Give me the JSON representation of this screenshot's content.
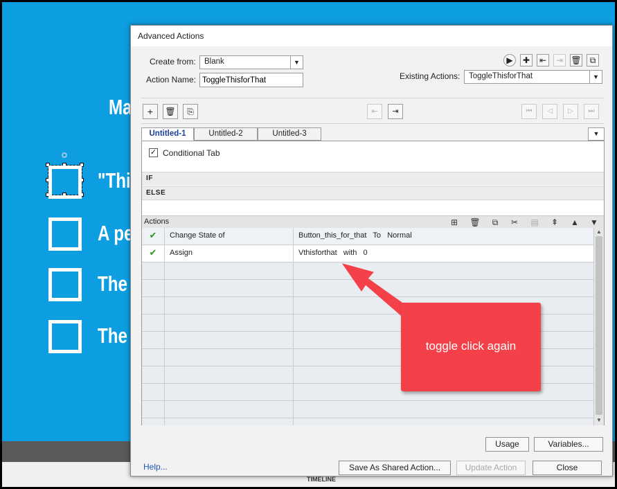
{
  "stage": {
    "title_fragment": "Ma",
    "options": [
      "\"This",
      "A pe",
      "The",
      "The"
    ]
  },
  "timeline": {
    "label": "TIMELINE"
  },
  "dialog": {
    "title": "Advanced Actions",
    "create_from": {
      "label": "Create from:",
      "value": "Blank"
    },
    "action_name": {
      "label": "Action Name:",
      "value": "ToggleThisforThat"
    },
    "existing_actions": {
      "label": "Existing Actions:",
      "value": "ToggleThisforThat"
    },
    "top_icons": [
      "preview-icon",
      "add-action-icon",
      "import-icon",
      "export-icon",
      "delete-action-icon",
      "duplicate-action-icon"
    ],
    "decision_icons": [
      "add-decision-icon",
      "delete-decision-icon",
      "duplicate-decision-icon"
    ],
    "tabs": [
      {
        "label": "Untitled-1",
        "active": true
      },
      {
        "label": "Untitled-2",
        "active": false
      },
      {
        "label": "Untitled-3",
        "active": false
      }
    ],
    "conditional_tab": {
      "label": "Conditional Tab",
      "checked": true
    },
    "if_label": "IF",
    "else_label": "ELSE",
    "actions_label": "Actions",
    "rows": [
      {
        "check": "✔",
        "action": "Change State of",
        "target": "Button_this_for_that   To   Normal"
      },
      {
        "check": "✔",
        "action": "Assign",
        "target": "Vthisforthat   with   0"
      }
    ],
    "empty_rows": 10,
    "buttons": {
      "usage": "Usage",
      "variables": "Variables...",
      "save_shared": "Save As Shared Action...",
      "update": "Update Action",
      "close": "Close"
    },
    "help": "Help..."
  },
  "annotation": {
    "text": "toggle click again",
    "color": "#f44149"
  }
}
